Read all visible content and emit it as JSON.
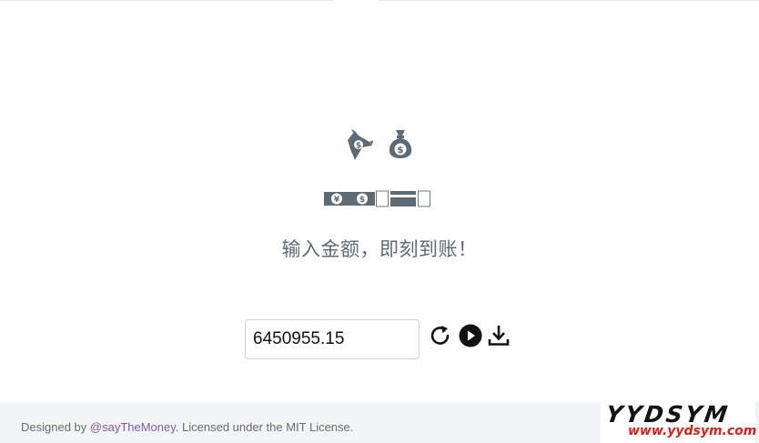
{
  "colors": {
    "icon_gray": "#5f6b73",
    "footer_bg": "#f3f4f5",
    "link": "#7b5ea7",
    "watermark_red": "#d8201a"
  },
  "hero": {
    "icons": [
      "money-flying-icon",
      "money-bag-icon"
    ]
  },
  "cards": {
    "icons": [
      "yen-banknote-icon",
      "dollar-banknote-icon",
      "blank-card-icon",
      "credit-card-icon",
      "blank-card-icon"
    ]
  },
  "headline": "输入金额，即刻到账！",
  "amount": {
    "value": "6450955.15",
    "placeholder": ""
  },
  "controls": [
    "refresh-icon",
    "play-icon",
    "download-icon"
  ],
  "footer": {
    "prefix": "Designed by ",
    "author_link": "@sayTheMoney",
    "suffix": ". Licensed under the MIT License."
  },
  "watermark": {
    "title": "YYDSYM",
    "url": "www.yydsym.com"
  }
}
